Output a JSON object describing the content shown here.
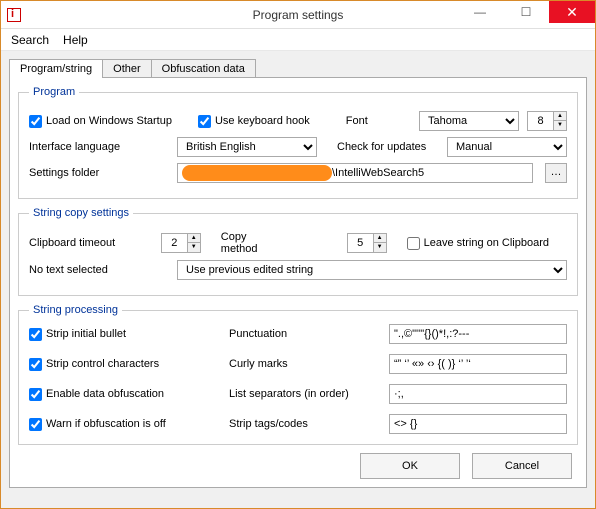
{
  "window": {
    "title": "Program settings"
  },
  "menubar": {
    "search": "Search",
    "help": "Help"
  },
  "tabs": {
    "program": "Program/string",
    "other": "Other",
    "obfuscation": "Obfuscation data"
  },
  "program_group": {
    "legend": "Program",
    "load_startup": "Load on Windows Startup",
    "keyboard_hook": "Use keyboard hook",
    "font_label": "Font",
    "font_name": "Tahoma",
    "font_size": "8",
    "interface_lang_label": "Interface language",
    "interface_lang": "British English",
    "check_updates_label": "Check for updates",
    "check_updates": "Manual",
    "settings_folder_label": "Settings folder",
    "settings_folder_suffix": "\\IntelliWebSearch5"
  },
  "string_copy_group": {
    "legend": "String copy settings",
    "clipboard_timeout_label": "Clipboard timeout",
    "clipboard_timeout": "2",
    "copy_method_label": "Copy method",
    "copy_method": "5",
    "leave_clipboard": "Leave string on Clipboard",
    "no_text_label": "No text selected",
    "no_text_value": "Use previous edited string"
  },
  "string_proc_group": {
    "legend": "String processing",
    "strip_bullet": "Strip initial bullet",
    "strip_control": "Strip control characters",
    "enable_obf": "Enable data obfuscation",
    "warn_obf": "Warn if obfuscation is off",
    "punctuation_label": "Punctuation",
    "punctuation_value": "\".,©\"''\"{}()*!,:?---",
    "curly_label": "Curly marks",
    "curly_value": "“” ‘’ «» ‹› {( )} ‘’ ’‘",
    "list_sep_label": "List separators (in order)",
    "list_sep_value": "·;,",
    "strip_tags_label": "Strip tags/codes",
    "strip_tags_value": "<> {}"
  },
  "buttons": {
    "ok": "OK",
    "cancel": "Cancel"
  }
}
